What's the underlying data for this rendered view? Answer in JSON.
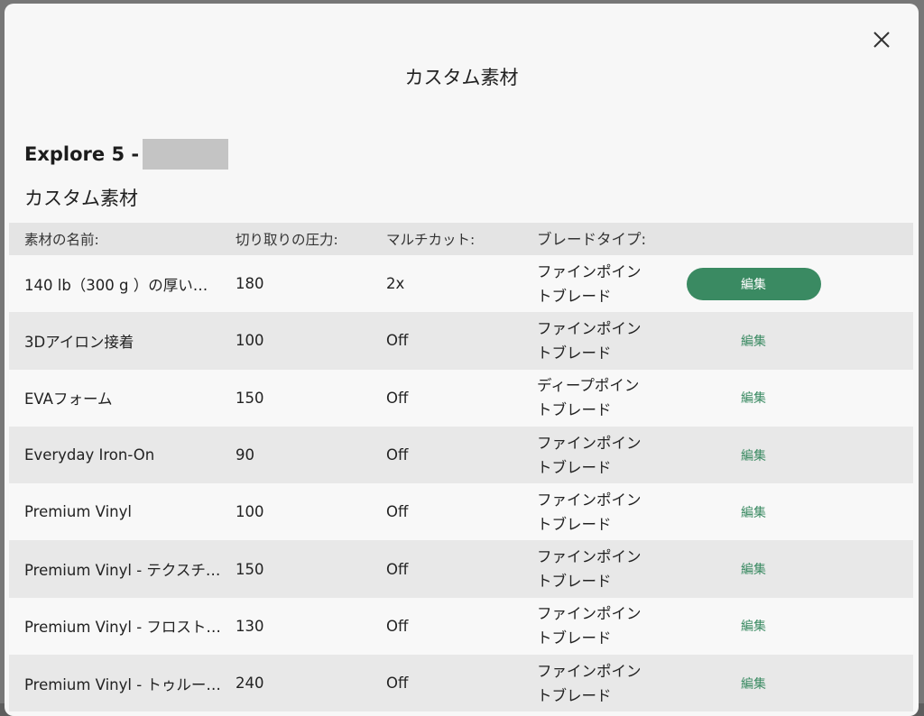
{
  "modal": {
    "title": "カスタム素材",
    "machine_name": "Explore 5 -",
    "section_title": "カスタム素材"
  },
  "table": {
    "headers": {
      "name": "素材の名前:",
      "pressure": "切り取りの圧力:",
      "multicut": "マルチカット:",
      "blade": "ブレードタイプ:"
    },
    "edit_label": "編集",
    "rows": [
      {
        "name": "140 lb（300 g ）の厚い…",
        "pressure": "180",
        "multicut": "2x",
        "blade_line1": "ファインポイン",
        "blade_line2": "トブレード"
      },
      {
        "name": "3Dアイロン接着",
        "pressure": "100",
        "multicut": "Off",
        "blade_line1": "ファインポイン",
        "blade_line2": "トブレード"
      },
      {
        "name": "EVAフォーム",
        "pressure": "150",
        "multicut": "Off",
        "blade_line1": "ディープポイン",
        "blade_line2": "トブレード"
      },
      {
        "name": "Everyday Iron-On",
        "pressure": "90",
        "multicut": "Off",
        "blade_line1": "ファインポイン",
        "blade_line2": "トブレード"
      },
      {
        "name": "Premium Vinyl",
        "pressure": "100",
        "multicut": "Off",
        "blade_line1": "ファインポイン",
        "blade_line2": "トブレード"
      },
      {
        "name": "Premium Vinyl - テクスチ…",
        "pressure": "150",
        "multicut": "Off",
        "blade_line1": "ファインポイン",
        "blade_line2": "トブレード"
      },
      {
        "name": "Premium Vinyl - フロスト…",
        "pressure": "130",
        "multicut": "Off",
        "blade_line1": "ファインポイン",
        "blade_line2": "トブレード"
      },
      {
        "name": "Premium Vinyl - トゥルー…",
        "pressure": "240",
        "multicut": "Off",
        "blade_line1": "ファインポイン",
        "blade_line2": "トブレード"
      }
    ]
  },
  "colors": {
    "accent": "#3a8a62"
  }
}
